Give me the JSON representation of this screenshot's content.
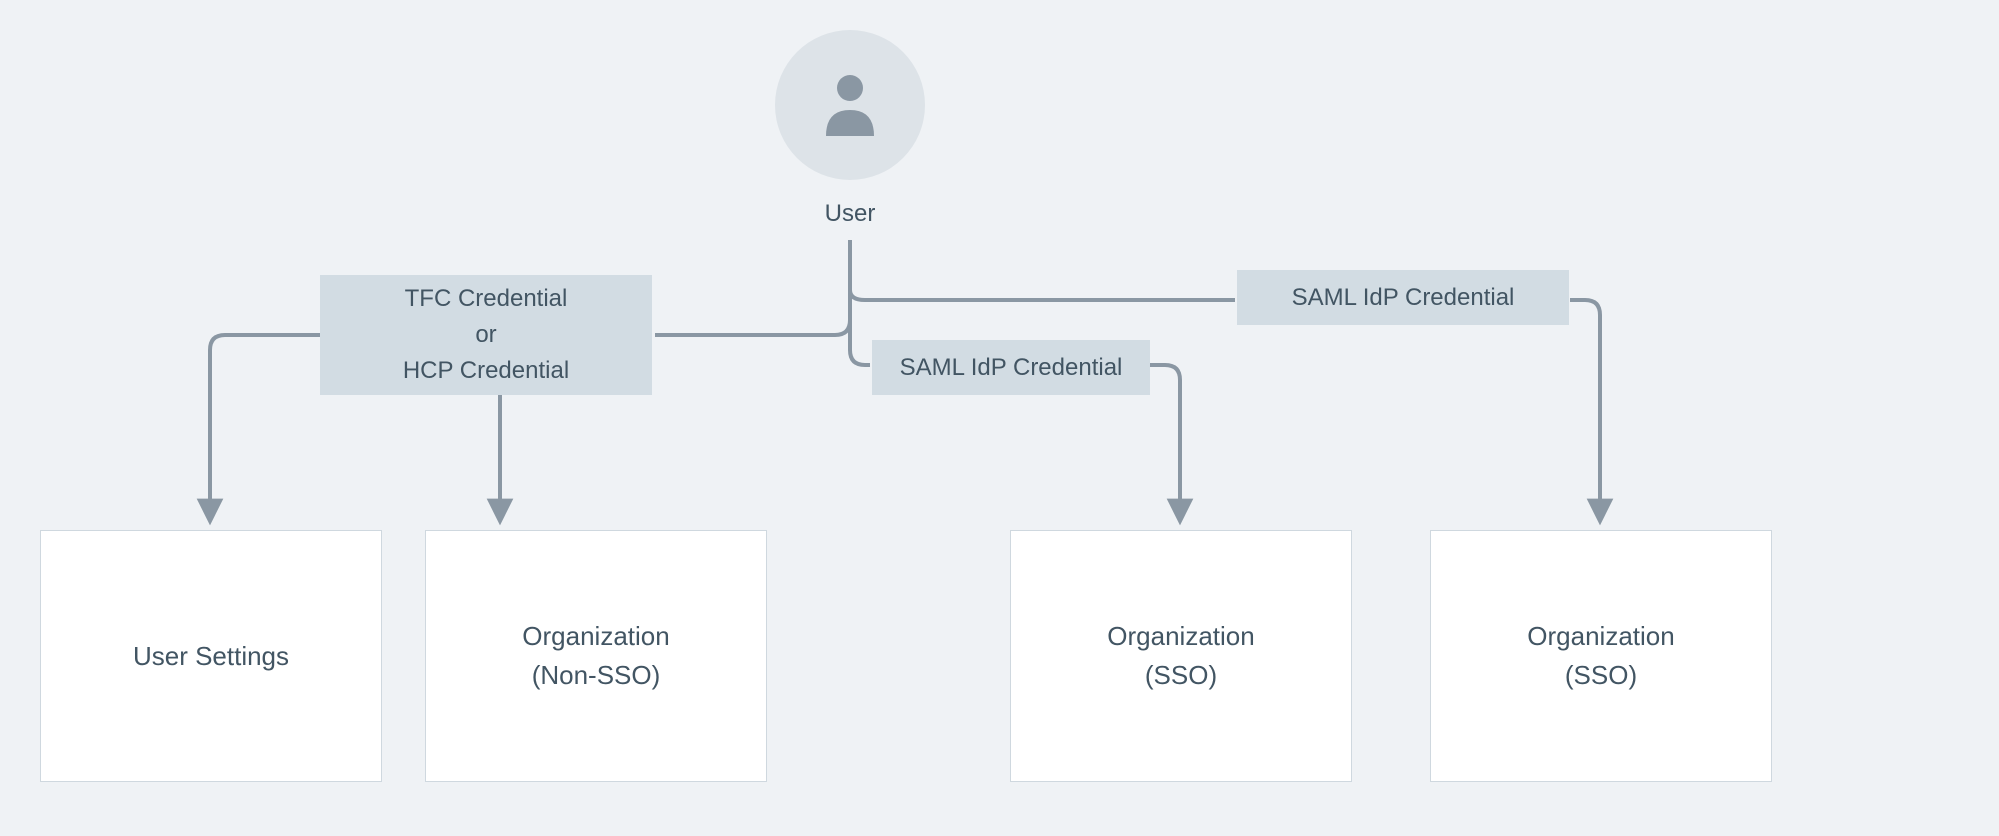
{
  "user": {
    "label": "User"
  },
  "credentials": {
    "tfc_hcp": {
      "line1": "TFC Credential",
      "line2": "or",
      "line3": "HCP Credential"
    },
    "saml_1": {
      "label": "SAML IdP Credential"
    },
    "saml_2": {
      "label": "SAML IdP Credential"
    }
  },
  "destinations": {
    "user_settings": {
      "label": "User Settings"
    },
    "org_non_sso": {
      "line1": "Organization",
      "line2": "(Non-SSO)"
    },
    "org_sso_1": {
      "line1": "Organization",
      "line2": "(SSO)"
    },
    "org_sso_2": {
      "line1": "Organization",
      "line2": "(SSO)"
    }
  },
  "colors": {
    "page_bg": "#eff2f5",
    "avatar_bg": "#dde3e8",
    "avatar_fg": "#8a97a3",
    "text": "#425563",
    "cred_bg": "#d2dce3",
    "dest_bg": "#ffffff",
    "dest_border": "#cfd8df",
    "line": "#8a97a3"
  }
}
